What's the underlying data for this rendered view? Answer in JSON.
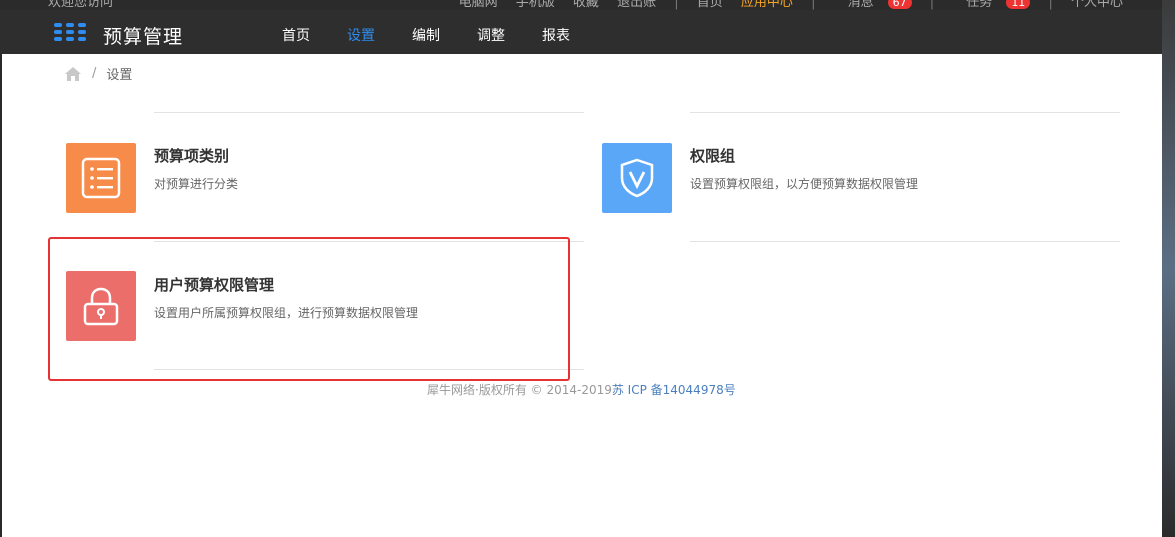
{
  "header": {
    "welcome": "欢迎您访问",
    "right_links": [
      "电脑网",
      "手机版",
      "收藏",
      "退出账",
      "首页"
    ],
    "highlight_link": "应用中心",
    "messages_label": "消息",
    "messages_count": "67",
    "tasks_label": "任务",
    "tasks_count": "11",
    "personal_label": "个人中心"
  },
  "nav": {
    "brand": "预算管理",
    "items": [
      {
        "label": "首页",
        "active": false
      },
      {
        "label": "设置",
        "active": true
      },
      {
        "label": "编制",
        "active": false
      },
      {
        "label": "调整",
        "active": false
      },
      {
        "label": "报表",
        "active": false
      }
    ]
  },
  "breadcrumb": {
    "home_icon": "home-icon",
    "current": "设置"
  },
  "tiles": [
    {
      "title": "预算项类别",
      "desc": "对预算进行分类",
      "icon": "list-icon",
      "color": "#f78c4a"
    },
    {
      "title": "权限组",
      "desc": "设置预算权限组，以方便预算数据权限管理",
      "icon": "shield-icon",
      "color": "#5ba7f7"
    },
    {
      "title": "用户预算权限管理",
      "desc": "设置用户所属预算权限组，进行预算数据权限管理",
      "icon": "lock-icon",
      "color": "#ec6e6a"
    }
  ],
  "footer": {
    "copyright": "犀牛网络·版权所有 © 2014-2019",
    "icp": "苏 ICP 备14044978号"
  }
}
